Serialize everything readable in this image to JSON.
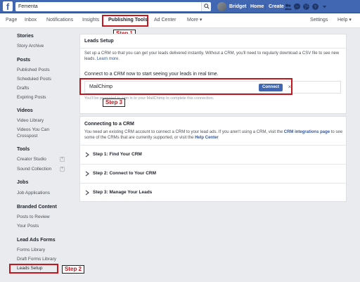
{
  "topbar": {
    "logo": "f",
    "search_value": "Fementa",
    "user_name": "Bridget",
    "home": "Home",
    "create": "Create"
  },
  "pagenav": {
    "tabs": [
      "Page",
      "Inbox",
      "Notifications",
      "Insights",
      "Publishing Tools",
      "Ad Center",
      "More ▾"
    ],
    "settings": "Settings",
    "help": "Help ▾"
  },
  "annotations": {
    "step1": "Step 1",
    "step2": "Step 2",
    "step3": "Step 3"
  },
  "sidebar": {
    "stories": {
      "title": "Stories",
      "items": [
        "Story Archive"
      ]
    },
    "posts": {
      "title": "Posts",
      "items": [
        "Published Posts",
        "Scheduled Posts",
        "Drafts",
        "Expiring Posts"
      ]
    },
    "videos": {
      "title": "Videos",
      "items": [
        "Video Library",
        "Videos You Can",
        "Crosspost"
      ]
    },
    "tools": {
      "title": "Tools",
      "items": [
        "Creator Studio",
        "Sound Collection"
      ]
    },
    "jobs": {
      "title": "Jobs",
      "items": [
        "Job Applications"
      ]
    },
    "branded": {
      "title": "Branded Content",
      "items": [
        "Posts to Review",
        "Your Posts"
      ]
    },
    "leadads": {
      "title": "Lead Ads Forms",
      "items": [
        "Forms Library",
        "Draft Forms Library",
        "Leads Setup"
      ]
    }
  },
  "leads_setup": {
    "title": "Leads Setup",
    "desc_line1": "Set up a CRM so that you can get your leads delivered instantly. Without a CRM, you'll need to regularly download a CSV file to see new leads.",
    "learn_more": "Learn more.",
    "connect_prompt": "Connect to a CRM now to start seeing your leads in real time.",
    "crm_name": "MailChimp",
    "connect_button": "Connect",
    "close_symbol": "×",
    "note": "You'll be prompted to sign in to your MailChimp to complete this connection."
  },
  "connecting": {
    "title": "Connecting to a CRM",
    "desc_a": "You need an existing CRM account to connect a CRM to your lead ads. If you aren't using a CRM, visit the",
    "crm_link": "CRM integrations page",
    "desc_b": "to see",
    "desc_c": "some of the CRMs that are currently supported, or visit the",
    "help_link": "Help Center",
    "steps": [
      "Step 1: Find Your CRM",
      "Step 2: Connect to Your CRM",
      "Step 3: Manage Your Leads"
    ]
  }
}
